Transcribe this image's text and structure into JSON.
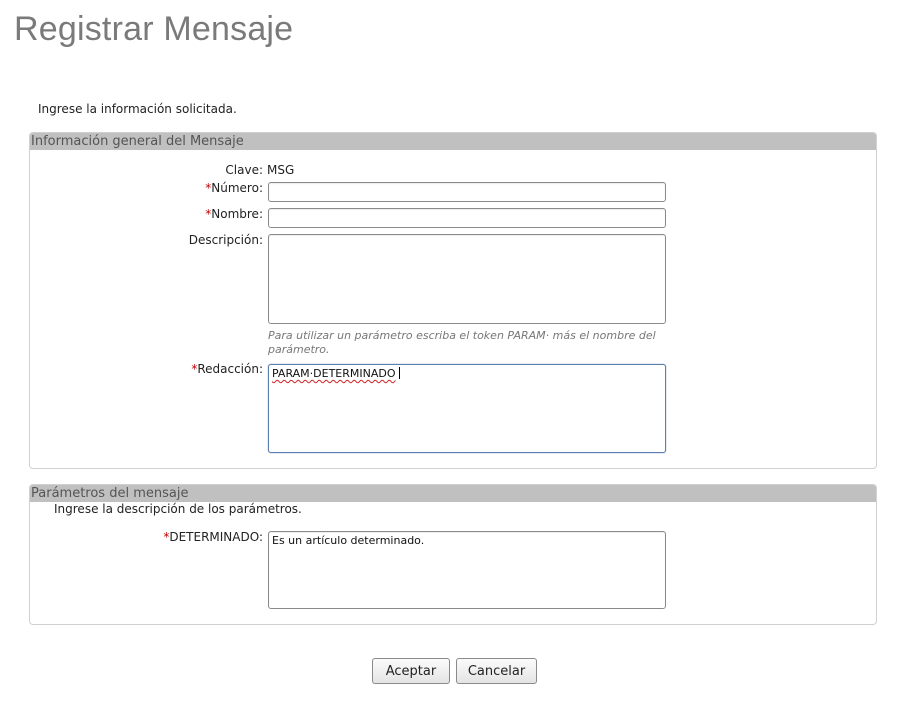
{
  "page": {
    "title": "Registrar Mensaje",
    "intro": "Ingrese la información solicitada."
  },
  "general_panel": {
    "header": "Información general del Mensaje",
    "clave_label": "Clave:",
    "clave_value": "MSG",
    "required_mark": "*",
    "numero_label": "Número:",
    "numero_value": "",
    "nombre_label": "Nombre:",
    "nombre_value": "",
    "descripcion_label": "Descripción:",
    "descripcion_value": "",
    "hint": "Para utilizar un parámetro escriba el token PARAM· más el nombre del parámetro.",
    "redaccion_label": "Redacción:",
    "redaccion_value": "PARAM·DETERMINADO"
  },
  "params_panel": {
    "header": "Parámetros del mensaje",
    "description": "Ingrese la descripción de los parámetros.",
    "param_label": "DETERMINADO:",
    "param_value": "Es un artículo determinado."
  },
  "buttons": {
    "accept": "Aceptar",
    "cancel": "Cancelar"
  },
  "colors": {
    "title": "#7a7a7a",
    "panel_header_bg": "#c0c0c0",
    "required": "#c00000",
    "focus_border": "#5a7fb0"
  }
}
